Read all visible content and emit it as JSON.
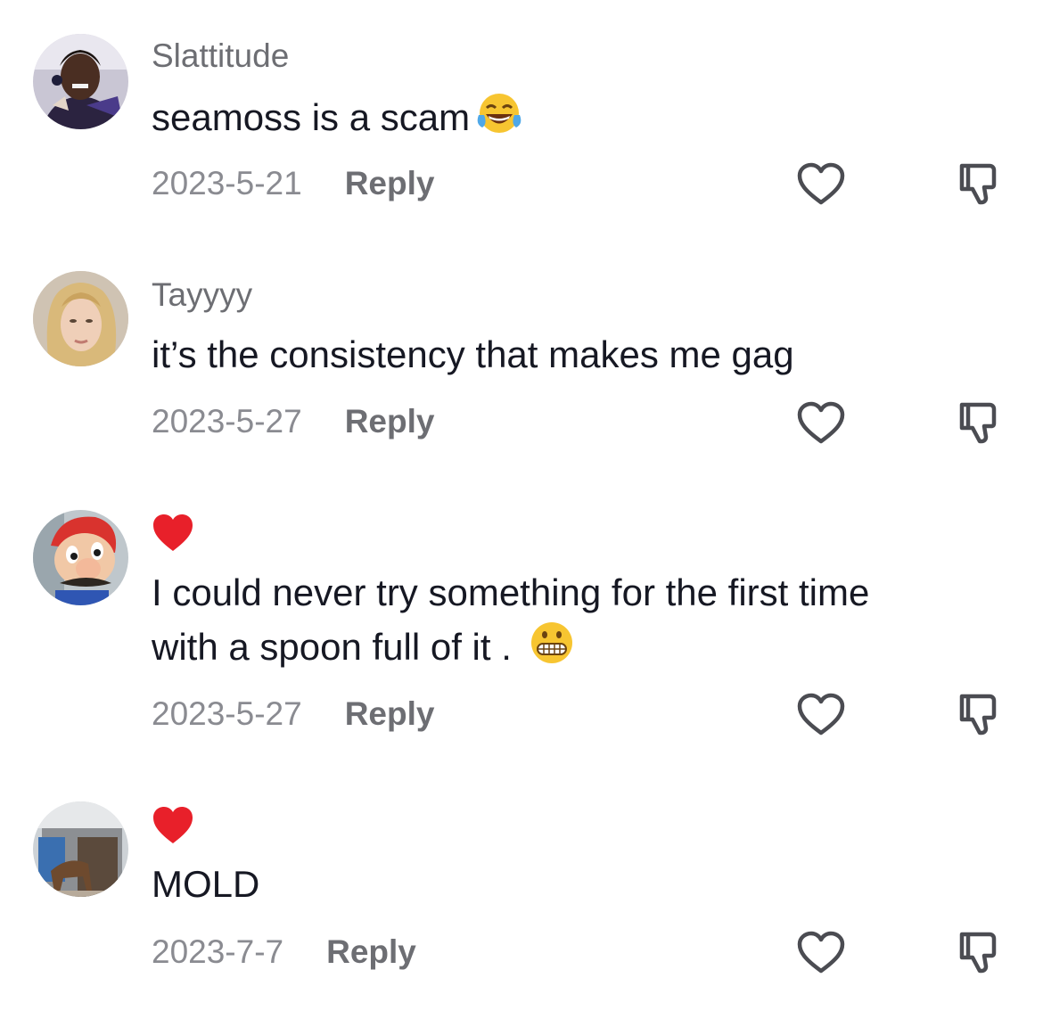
{
  "comments": [
    {
      "username": "Slattitude",
      "text": "seamoss is a scam",
      "emoji": "laughing-tears-emoji",
      "date": "2023-5-21",
      "reply_label": "Reply",
      "creator_liked": false
    },
    {
      "username": "Tayyyy",
      "text": "it’s the consistency that makes me gag",
      "date": "2023-5-27",
      "reply_label": "Reply",
      "creator_liked": false
    },
    {
      "username": "",
      "creator_liked": true,
      "text_line1": "I could never try something for the first time",
      "text_line2": "with a spoon full of it .",
      "emoji": "grimacing-emoji",
      "date": "2023-5-27",
      "reply_label": "Reply"
    },
    {
      "username": "",
      "creator_liked": true,
      "text": "MOLD",
      "date": "2023-7-7",
      "reply_label": "Reply"
    }
  ],
  "colors": {
    "username": "#6d6e73",
    "date": "#8a8b91",
    "text": "#161823",
    "heart_red": "#e8202a",
    "icon_stroke": "#4b4c52"
  },
  "icons": {
    "like": "heart-outline-icon",
    "dislike": "thumbs-down-icon",
    "creator_like": "red-heart-icon"
  }
}
